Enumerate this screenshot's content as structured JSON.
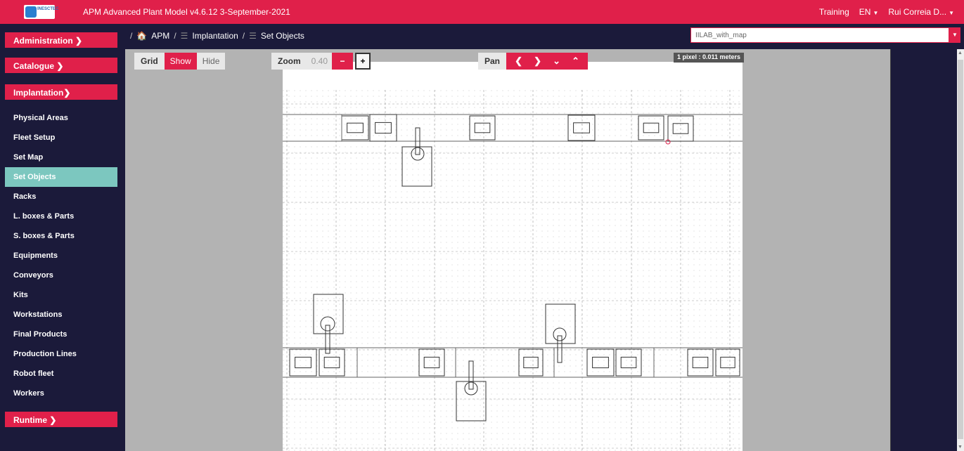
{
  "header": {
    "logo_text": "INESCTEC",
    "app_title": "APM Advanced Plant Model   v4.6.12   3-September-2021",
    "mode": "Training",
    "language": "EN",
    "user": "Rui Correia D..."
  },
  "breadcrumb": {
    "items": [
      "APM",
      "Implantation",
      "Set Objects"
    ],
    "map_select_value": "IILAB_with_map"
  },
  "sidebar": {
    "administration": "Administration ❯",
    "catalogue": "Catalogue ❯",
    "implantation": "Implantation❯",
    "items": [
      "Physical Areas",
      "Fleet Setup",
      "Set Map",
      "Set Objects",
      "Racks",
      "L. boxes & Parts",
      "S. boxes & Parts",
      "Equipments",
      "Conveyors",
      "Kits",
      "Workstations",
      "Final Products",
      "Production Lines",
      "Robot fleet",
      "Workers"
    ],
    "active_item": "Set Objects",
    "runtime": "Runtime ❯"
  },
  "toolbar": {
    "grid_label": "Grid",
    "grid_show": "Show",
    "grid_hide": "Hide",
    "zoom_label": "Zoom",
    "zoom_value": "0.40",
    "zoom_minus": "−",
    "zoom_plus": "+",
    "pan_label": "Pan",
    "pan_left": "❮",
    "pan_right": "❯",
    "pan_down": "⌄",
    "pan_up": "⌃",
    "scale": "1 pixel : 0.011 meters"
  },
  "colors": {
    "accent": "#e0204a",
    "dark": "#1b1a3a",
    "active_item": "#7cc7bf",
    "canvas_bg": "#b3b3b3"
  }
}
